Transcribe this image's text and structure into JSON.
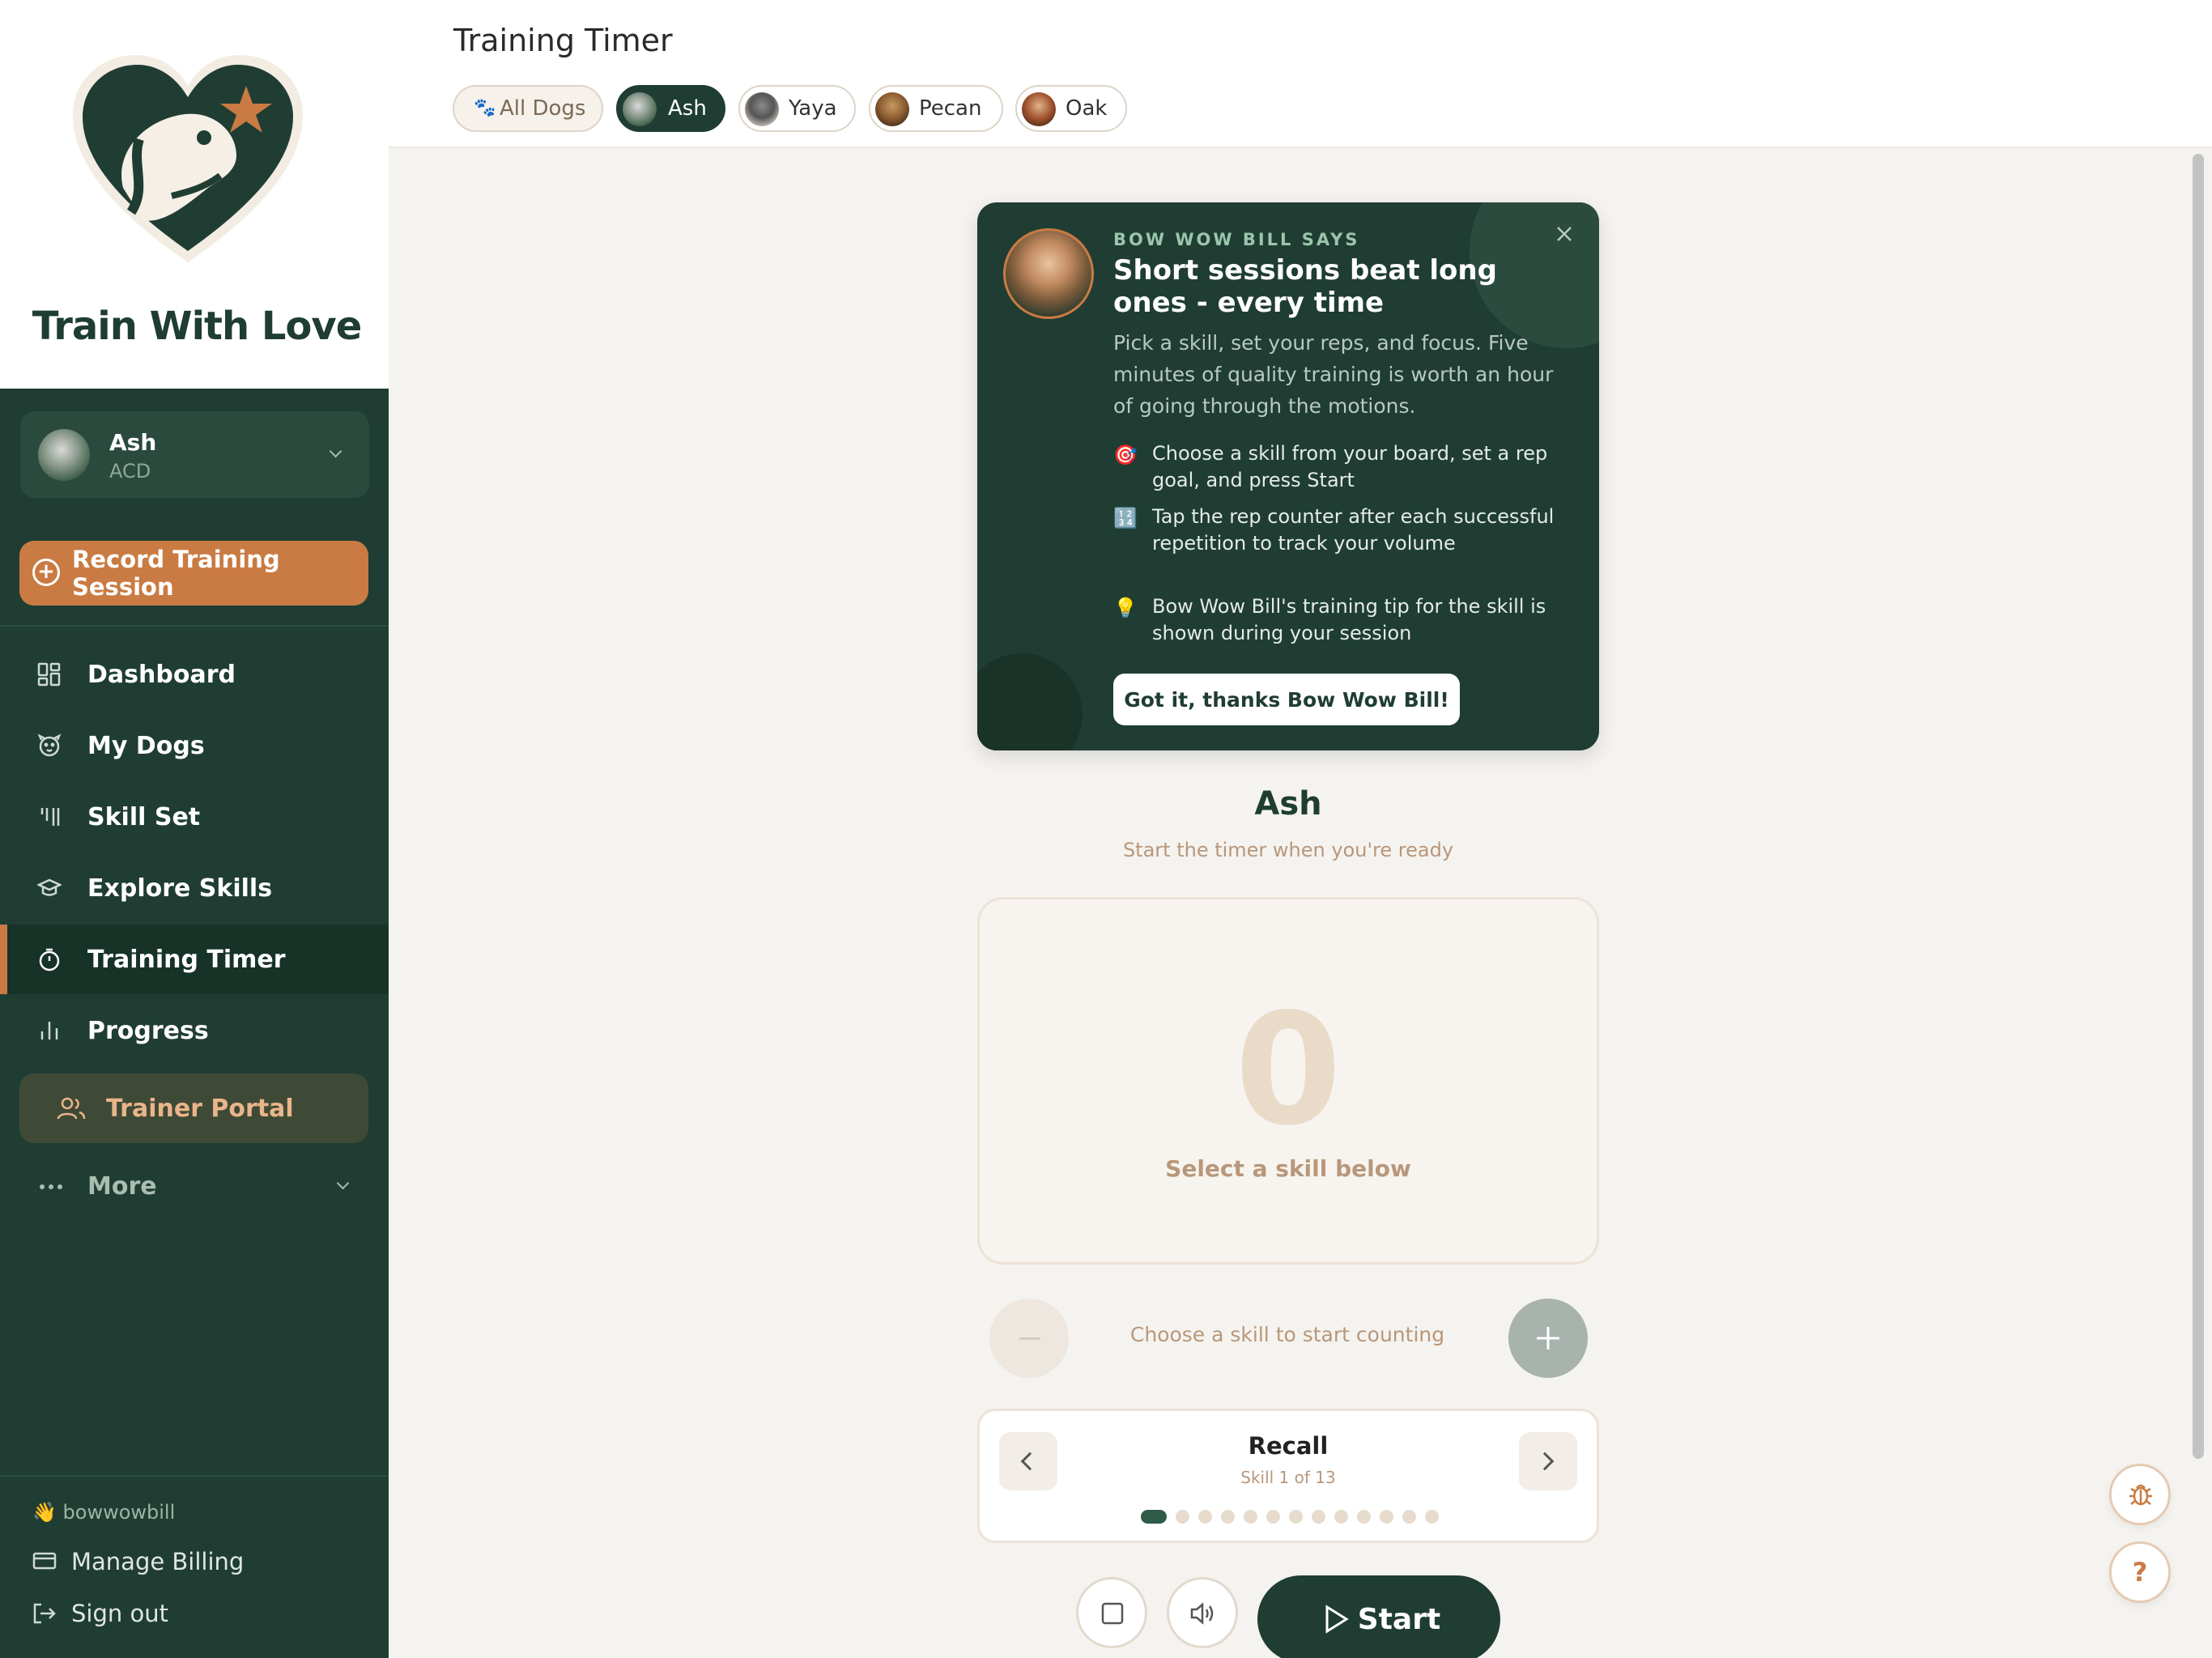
{
  "brand": {
    "title": "Train With Love"
  },
  "dog_selector": {
    "name": "Ash",
    "breed": "ACD"
  },
  "record_button": "Record Training Session",
  "nav": [
    {
      "label": "Dashboard",
      "icon": "grid-icon"
    },
    {
      "label": "My Dogs",
      "icon": "dog-icon"
    },
    {
      "label": "Skill Set",
      "icon": "skill-set-icon"
    },
    {
      "label": "Explore Skills",
      "icon": "graduation-cap-icon"
    },
    {
      "label": "Training Timer",
      "icon": "timer-icon",
      "active": true
    },
    {
      "label": "Progress",
      "icon": "bar-chart-icon"
    }
  ],
  "trainer_portal": "Trainer Portal",
  "more": "More",
  "footer": {
    "user": "bowwowbill",
    "billing": "Manage Billing",
    "signout": "Sign out"
  },
  "header": {
    "title": "Training Timer"
  },
  "dog_tabs": [
    {
      "label": "All Dogs"
    },
    {
      "label": "Ash",
      "selected": true
    },
    {
      "label": "Yaya"
    },
    {
      "label": "Pecan"
    },
    {
      "label": "Oak"
    }
  ],
  "tip": {
    "kicker": "BOW WOW BILL SAYS",
    "heading": "Short sessions beat long ones - every time",
    "body": "Pick a skill, set your reps, and focus. Five minutes of quality training is worth an hour of going through the motions.",
    "items": [
      "Choose a skill from your board, set a rep goal, and press Start",
      "Tap the rep counter after each successful repetition to track your volume",
      "Bow Wow Bill's training tip for the skill is shown during your session"
    ],
    "button": "Got it, thanks Bow Wow Bill!"
  },
  "session": {
    "dog_name": "Ash",
    "subtitle": "Start the timer when you're ready",
    "count": "0",
    "counter_label": "Select a skill below",
    "count_hint": "Choose a skill to start counting"
  },
  "skill": {
    "name": "Recall",
    "position": "Skill 1 of 13",
    "current_index": 1,
    "total": 13
  },
  "start_button": "Start",
  "colors": {
    "sidebar": "#1f3d33",
    "accent": "#c97b43",
    "background": "#f5f3ef"
  }
}
